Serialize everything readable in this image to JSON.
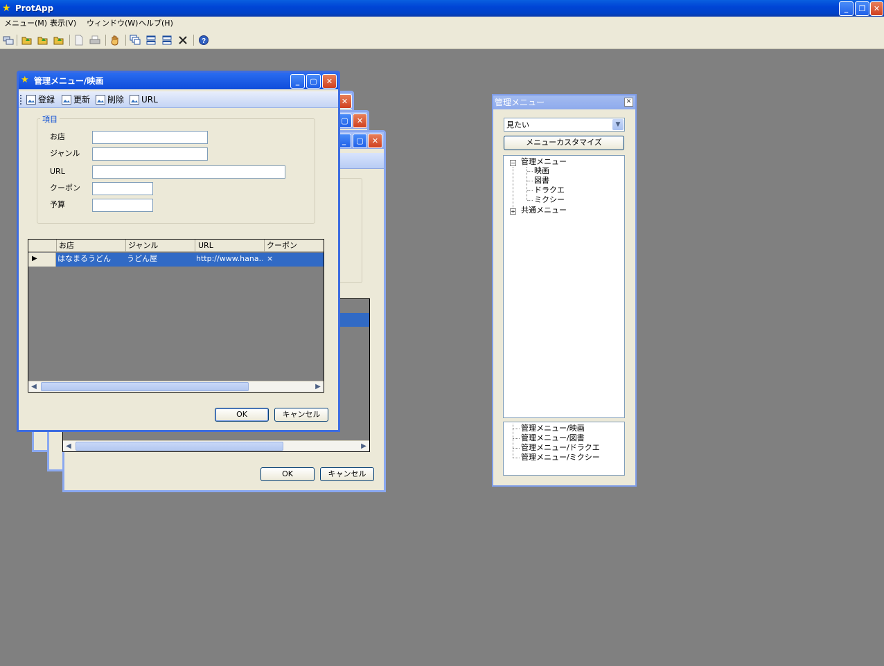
{
  "app": {
    "title": "ProtApp",
    "menu": [
      "メニュー(M)",
      "表示(V)",
      "ウィンドウ(W)",
      "ヘルプ(H)"
    ],
    "window_buttons": {
      "minimize": "_",
      "restore": "❐",
      "close": "✕"
    }
  },
  "toolbar": {
    "icons": [
      "tile-icon",
      "folder-open-icon",
      "folder-open-icon",
      "folder-open-icon",
      "document-icon",
      "print-icon",
      "hand-icon",
      "cascade-icon",
      "tile-horizontal-icon",
      "tile-vertical-icon",
      "close-icon",
      "help-icon"
    ]
  },
  "back_windows": {
    "ok_label": "OK",
    "cancel_label": "キャンセル"
  },
  "movie_window": {
    "title": "管理メニュー/映画",
    "toolbar": {
      "register": "登録",
      "update": "更新",
      "delete": "削除",
      "url": "URL"
    },
    "group_label": "項目",
    "fields": {
      "shop_label": "お店",
      "genre_label": "ジャンル",
      "url_label": "URL",
      "coupon_label": "クーポン",
      "budget_label": "予算"
    },
    "grid": {
      "columns": [
        "お店",
        "ジャンル",
        "URL",
        "クーポン"
      ],
      "rows": [
        {
          "shop": "はなまるうどん",
          "genre": "うどん屋",
          "url": "http://www.hana...",
          "coupon": "×"
        }
      ]
    },
    "ok_label": "OK",
    "cancel_label": "キャンセル"
  },
  "admin_panel": {
    "title": "管理メニュー",
    "dropdown_value": "見たい",
    "customize_label": "メニューカスタマイズ",
    "tree": {
      "root": "管理メニュー",
      "children": [
        "映画",
        "図書",
        "ドラクエ",
        "ミクシー"
      ],
      "root2": "共通メニュー"
    },
    "open_windows": [
      "管理メニュー/映画",
      "管理メニュー/図書",
      "管理メニュー/ドラクエ",
      "管理メニュー/ミクシー"
    ]
  }
}
